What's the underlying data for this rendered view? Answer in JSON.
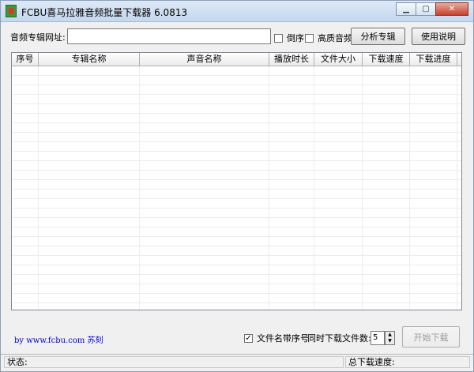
{
  "window": {
    "title": "FCBU喜马拉雅音频批量下载器 6.0813"
  },
  "url_row": {
    "label": "音频专辑网址:",
    "value": "",
    "reverse_label": "倒序",
    "reverse_checked": false,
    "hq_label": "高质音频",
    "hq_checked": false,
    "analyze_button": "分析专辑",
    "help_button": "使用说明"
  },
  "table": {
    "columns": [
      "序号",
      "专辑名称",
      "声音名称",
      "播放时长",
      "文件大小",
      "下载速度",
      "下载进度"
    ],
    "rows": []
  },
  "footer": {
    "credit_prefix": "by www.fcbu.com",
    "credit_name": "苏刻",
    "filename_seq_label": "文件名带序号",
    "filename_seq_checked": true,
    "concurrent_label": "同时下载文件数:",
    "concurrent_value": "5",
    "start_button": "开始下载"
  },
  "statusbar": {
    "status_label": "状态:",
    "total_speed_label": "总下载速度:"
  }
}
